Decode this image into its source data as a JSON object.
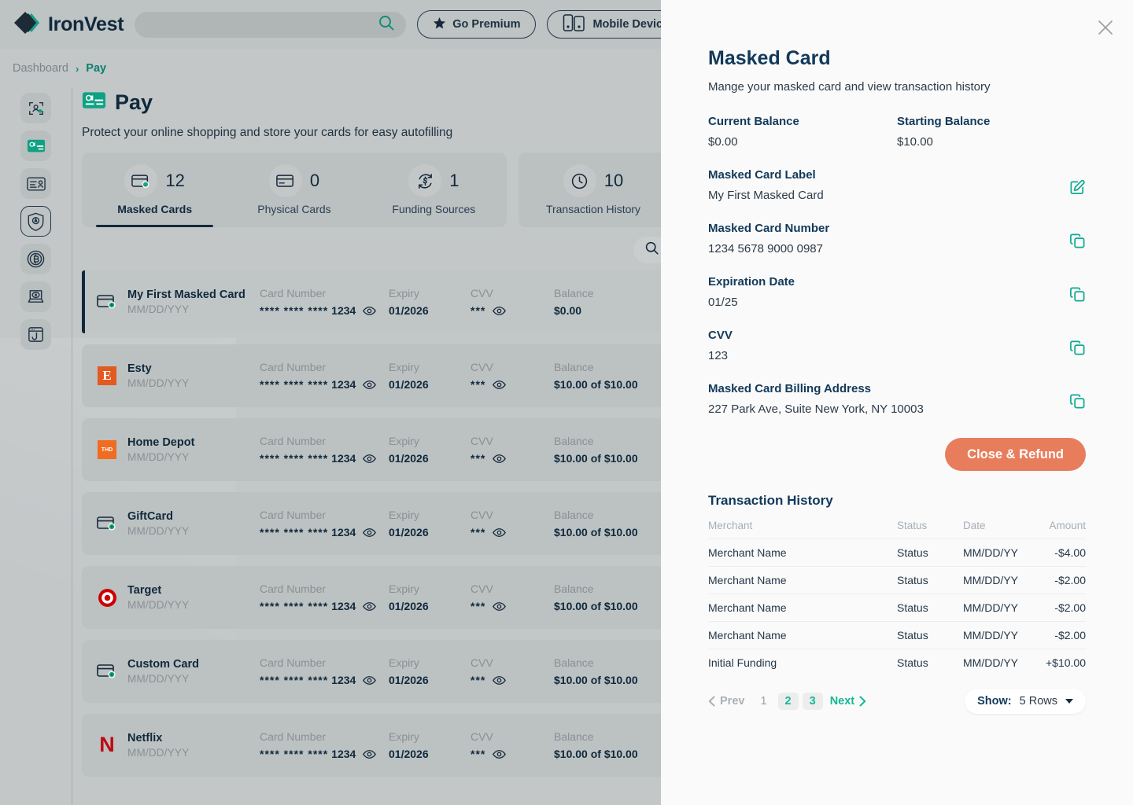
{
  "app": {
    "brand_name": "IronVest",
    "brand_logo_icon": "ironvest-diamond-logo"
  },
  "topbar": {
    "search_placeholder": "",
    "search_value": "",
    "search_icon": "search-icon",
    "go_premium_label": "Go Premium",
    "go_premium_icon": "star-icon",
    "mobile_devices_label": "Mobile Devices",
    "mobile_devices_icon": "mobile-devices-icon"
  },
  "breadcrumb": {
    "root": "Dashboard",
    "separator": "›",
    "current": "Pay"
  },
  "sidebar": {
    "items": [
      {
        "icon": "identity-scan-icon",
        "active": false
      },
      {
        "icon": "payment-card-icon",
        "active": false
      },
      {
        "icon": "id-card-icon",
        "active": false
      },
      {
        "icon": "shield-lock-icon",
        "active": true
      },
      {
        "icon": "bitcoin-icon",
        "active": false
      },
      {
        "icon": "webcam-privacy-icon",
        "active": false
      },
      {
        "icon": "phishing-hook-icon",
        "active": false
      }
    ]
  },
  "page": {
    "icon": "pay-card-icon",
    "title": "Pay",
    "subtitle": "Protect your online shopping and store your cards for easy autofilling"
  },
  "stats": {
    "group_a": [
      {
        "icon": "masked-card-icon",
        "count": "12",
        "label": "Masked Cards",
        "selected": true
      },
      {
        "icon": "physical-card-icon",
        "count": "0",
        "label": "Physical Cards",
        "selected": false
      },
      {
        "icon": "funding-source-icon",
        "count": "1",
        "label": "Funding Sources",
        "selected": false
      }
    ],
    "group_b": [
      {
        "icon": "clock-icon",
        "count": "10",
        "label": "Transaction History",
        "selected": false
      }
    ]
  },
  "list_search": {
    "icon": "search-icon",
    "placeholder": "",
    "value": ""
  },
  "card_list": {
    "columns": {
      "number": "Card Number",
      "expiry": "Expiry",
      "cvv": "CVV",
      "balance": "Balance"
    },
    "rows": [
      {
        "logo": "masked-card-icon",
        "name": "My First Masked Card",
        "date": "MM/DD/YYY",
        "number": "**** **** ****",
        "last4": "1234",
        "expiry": "01/2026",
        "cvv": "***",
        "balance": "$0.00",
        "selected": true
      },
      {
        "logo": "etsy-logo",
        "name": "Esty",
        "date": "MM/DD/YYY",
        "number": "**** **** ****",
        "last4": "1234",
        "expiry": "01/2026",
        "cvv": "***",
        "balance": "$10.00 of $10.00",
        "selected": false
      },
      {
        "logo": "home-depot-logo",
        "name": "Home Depot",
        "date": "MM/DD/YYY",
        "number": "**** **** ****",
        "last4": "1234",
        "expiry": "01/2026",
        "cvv": "***",
        "balance": "$10.00 of $10.00",
        "selected": false
      },
      {
        "logo": "masked-card-icon",
        "name": "GiftCard",
        "date": "MM/DD/YYY",
        "number": "**** **** ****",
        "last4": "1234",
        "expiry": "01/2026",
        "cvv": "***",
        "balance": "$10.00 of $10.00",
        "selected": false
      },
      {
        "logo": "target-logo",
        "name": "Target",
        "date": "MM/DD/YYY",
        "number": "**** **** ****",
        "last4": "1234",
        "expiry": "01/2026",
        "cvv": "***",
        "balance": "$10.00 of $10.00",
        "selected": false
      },
      {
        "logo": "masked-card-icon",
        "name": "Custom Card",
        "date": "MM/DD/YYY",
        "number": "**** **** ****",
        "last4": "1234",
        "expiry": "01/2026",
        "cvv": "***",
        "balance": "$10.00 of $10.00",
        "selected": false
      },
      {
        "logo": "netflix-logo",
        "name": "Netflix",
        "date": "MM/DD/YYY",
        "number": "**** **** ****",
        "last4": "1234",
        "expiry": "01/2026",
        "cvv": "***",
        "balance": "$10.00 of $10.00",
        "selected": false
      }
    ]
  },
  "panel": {
    "close_icon": "close-icon",
    "title": "Masked Card",
    "subtitle": "Mange your masked card and view transaction history",
    "current_balance_label": "Current Balance",
    "current_balance_value": "$0.00",
    "starting_balance_label": "Starting Balance",
    "starting_balance_value": "$10.00",
    "fields": [
      {
        "label": "Masked Card Label",
        "value": "My First Masked Card",
        "icon": "edit-icon"
      },
      {
        "label": "Masked Card Number",
        "value": "1234 5678 9000 0987",
        "icon": "copy-icon"
      },
      {
        "label": "Expiration Date",
        "value": "01/25",
        "icon": "copy-icon"
      },
      {
        "label": "CVV",
        "value": "123",
        "icon": "copy-icon"
      },
      {
        "label": "Masked Card Billing Address",
        "value": "227 Park Ave, Suite  New York, NY 10003",
        "icon": "copy-icon"
      }
    ],
    "refund_button": "Close & Refund",
    "transactions": {
      "title": "Transaction History",
      "columns": {
        "merchant": "Merchant",
        "status": "Status",
        "date": "Date",
        "amount": "Amount"
      },
      "rows": [
        {
          "merchant": "Merchant Name",
          "status": "Status",
          "date": "MM/DD/YY",
          "amount": "-$4.00",
          "sign": "neg"
        },
        {
          "merchant": "Merchant Name",
          "status": "Status",
          "date": "MM/DD/YY",
          "amount": "-$2.00",
          "sign": "neg"
        },
        {
          "merchant": "Merchant Name",
          "status": "Status",
          "date": "MM/DD/YY",
          "amount": "-$2.00",
          "sign": "neg"
        },
        {
          "merchant": "Merchant Name",
          "status": "Status",
          "date": "MM/DD/YY",
          "amount": "-$2.00",
          "sign": "neg"
        },
        {
          "merchant": "Initial Funding",
          "status": "Status",
          "date": "MM/DD/YY",
          "amount": "+$10.00",
          "sign": "pos"
        }
      ]
    },
    "pagination": {
      "prev_label": "Prev",
      "next_label": "Next",
      "pages": [
        {
          "label": "1",
          "active": false
        },
        {
          "label": "2",
          "active": true
        },
        {
          "label": "3",
          "active": true
        }
      ],
      "show_prefix": "Show:",
      "show_value": "5 Rows",
      "caret_icon": "chevron-down-icon"
    }
  },
  "colors": {
    "brand_teal": "#0eab92",
    "navy": "#12395a",
    "accent_coral": "#e87d5c",
    "amount_positive": "#14b896",
    "amount_negative": "#ec7a57"
  }
}
